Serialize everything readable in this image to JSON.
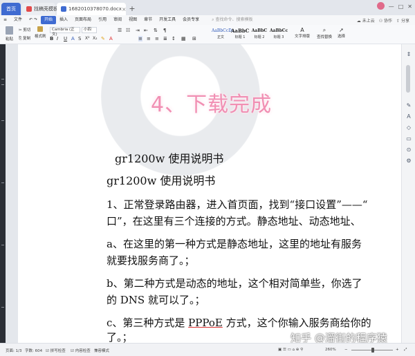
{
  "tabs": {
    "home": "首页",
    "draft": "找稿壳模板",
    "doc": "1682010378070.docx"
  },
  "titlebar_right": {
    "login_label": "未上云",
    "collab_label": "协作",
    "share_label": "分享"
  },
  "menu": {
    "items": [
      "文件",
      "开始",
      "插入",
      "页面布局",
      "引用",
      "审阅",
      "视图",
      "章节",
      "开发工具",
      "会员专享"
    ],
    "active": "开始",
    "search_placeholder": "查找命令、搜索模板"
  },
  "ribbon": {
    "paste": "粘贴",
    "cut": "剪切",
    "copy": "复制",
    "format_painter": "格式刷",
    "font_name": "Cambria (正文)",
    "font_size": "小四",
    "styles": [
      {
        "sample": "AaBbCcDc",
        "name": "正文"
      },
      {
        "sample": "AaBbC",
        "name": "标题 1"
      },
      {
        "sample": "AaBbC",
        "name": "标题 2"
      },
      {
        "sample": "AaBbCc",
        "name": "标题 3"
      }
    ],
    "text_tools": "文字排版",
    "find_replace": "查找替换",
    "select": "选择"
  },
  "document": {
    "overlay_caption": "4、下载完成",
    "title1": "gr1200w 使用说明书",
    "title2": "gr1200w 使用说明书",
    "p1_line1": "1、正常登录路由器，进入首页面，找到“接口设置”——“",
    "p1_line2": "口”，在这里有三个连接的方式。静态地址、动态地址、",
    "p2_line1": "a、在这里的第一种方式是静态地址，这里的地址有服务",
    "p2_line2": "就要找服务商了。；",
    "p3_line1": "b、第二种方式是动态的地址，这个相对简单些，你选了",
    "p3_line2": "的 DNS 就可以了。；",
    "p4_line1_a": "c、第三种方式是 ",
    "p4_line1_ul": "PPPoE",
    "p4_line1_b": " 方式，这个你输入服务商给你的",
    "p4_line2": "了。；"
  },
  "status": {
    "page": "页面: 1/3",
    "words": "字数: 604",
    "spell": "拼写检查",
    "content_check": "内容检查",
    "compat": "兼容模式",
    "zoom": "260%",
    "zoom_value": 260
  },
  "watermark_text": "知乎 @溜街的程序猿"
}
